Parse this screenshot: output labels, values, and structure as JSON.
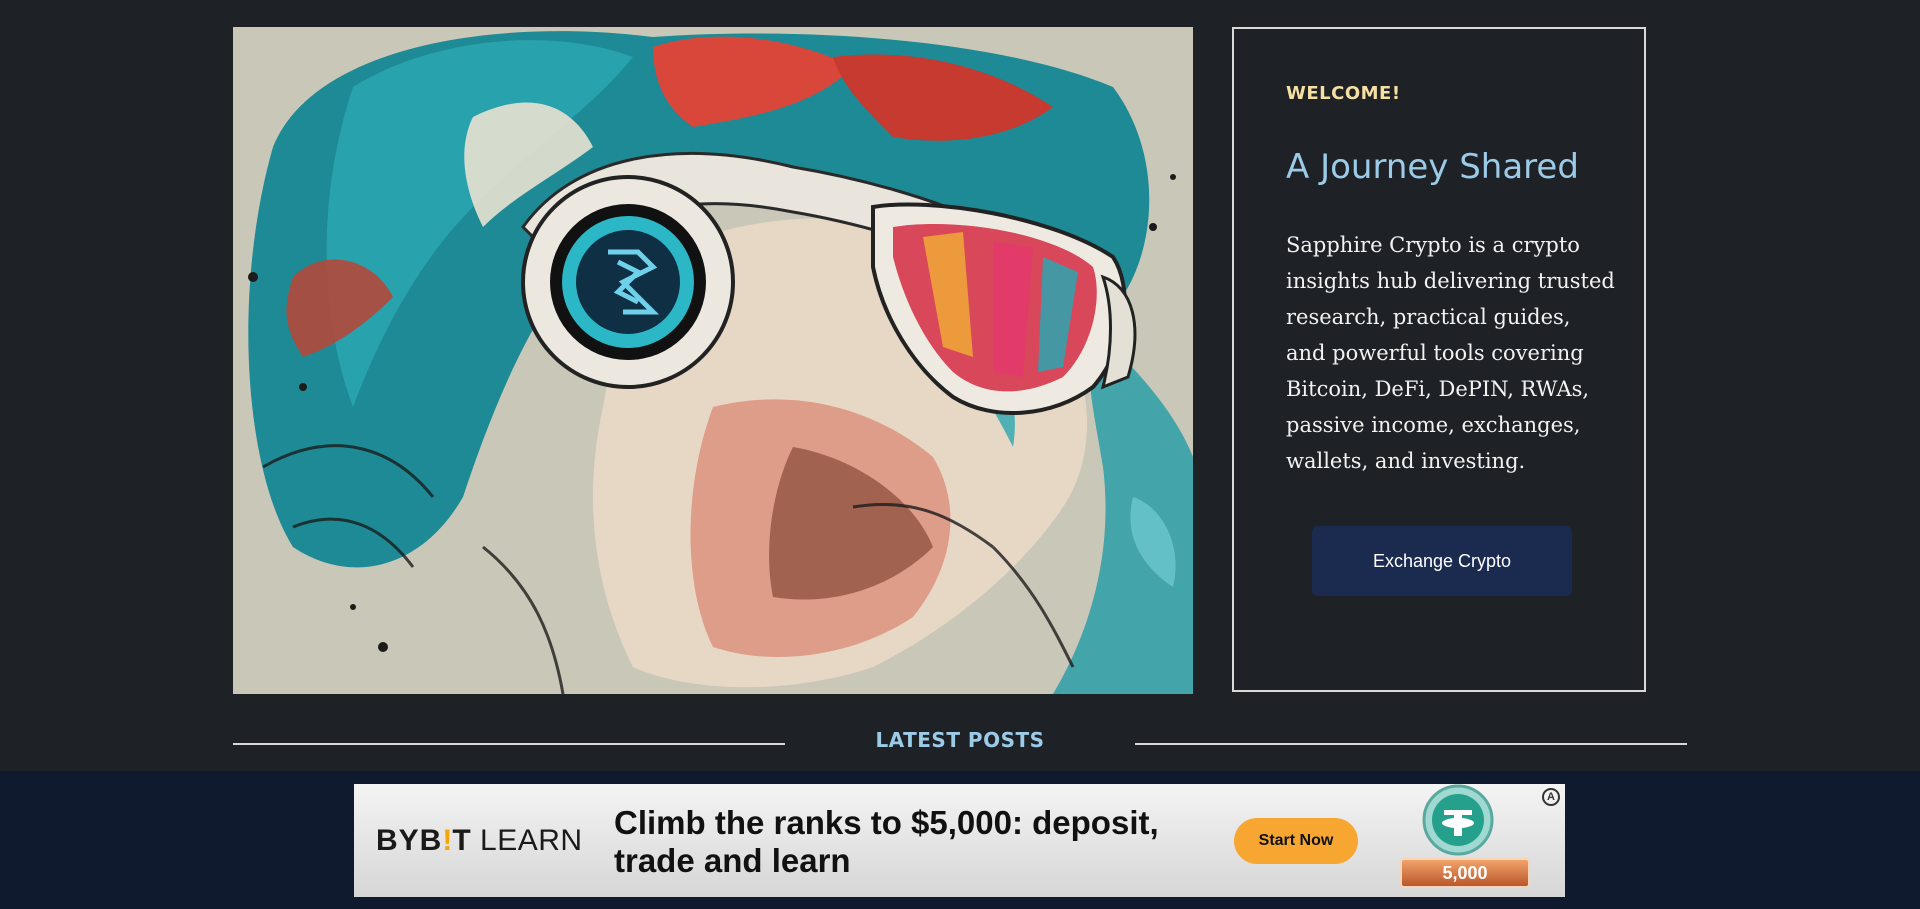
{
  "hero": {
    "image_alt": "Stylized illustration of a man with teal and red hair wearing headphones with the Sapphire Crypto logo and reflective ski goggles"
  },
  "welcome": {
    "kicker": "WELCOME!",
    "title": "A Journey Shared",
    "body": "Sapphire Crypto is a crypto insights hub delivering trusted research, practical guides, and powerful tools covering Bitcoin, DeFi, DePIN, RWAs, passive income, exchanges, wallets, and investing.",
    "button_label": "Exchange Crypto"
  },
  "latest": {
    "title": "LATEST POSTS"
  },
  "ad": {
    "brand_main": "BYB",
    "brand_bang": "!",
    "brand_end": "T",
    "brand_sub": "LEARN",
    "headline": "Climb the ranks to $5,000: deposit, trade and learn",
    "cta_label": "Start Now",
    "badge_value": "5,000",
    "choices_label": "A"
  },
  "colors": {
    "page_bg": "#1e2226",
    "accent_blue": "#9ccbe8",
    "kicker_gold": "#f6dfa2",
    "button_navy": "#1b2b4f",
    "ad_strip": "#0f1a2e",
    "ad_cta": "#f7a632"
  },
  "icons": {
    "hero_logo": "sapphire-s-logo-icon",
    "ad_coin": "tether-coin-icon",
    "ad_choices": "adchoices-icon"
  }
}
